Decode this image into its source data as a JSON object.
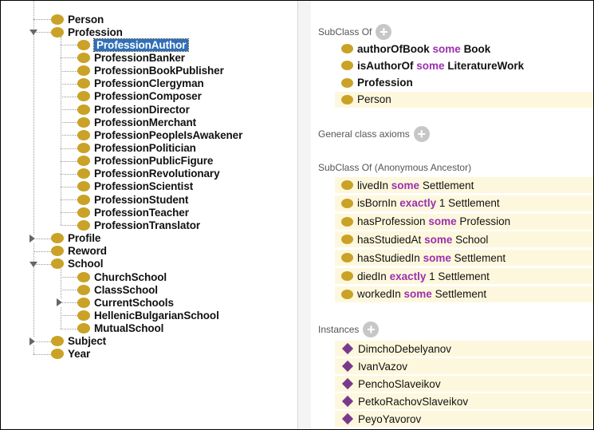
{
  "tree": {
    "items": [
      {
        "label": "Person",
        "level": 0,
        "expander": "none"
      },
      {
        "label": "Profession",
        "level": 0,
        "expander": "open"
      },
      {
        "label": "ProfessionAuthor",
        "level": 1,
        "expander": "none",
        "selected": true
      },
      {
        "label": "ProfessionBanker",
        "level": 1,
        "expander": "none"
      },
      {
        "label": "ProfessionBookPublisher",
        "level": 1,
        "expander": "none"
      },
      {
        "label": "ProfessionClergyman",
        "level": 1,
        "expander": "none"
      },
      {
        "label": "ProfessionComposer",
        "level": 1,
        "expander": "none"
      },
      {
        "label": "ProfessionDirector",
        "level": 1,
        "expander": "none"
      },
      {
        "label": "ProfessionMerchant",
        "level": 1,
        "expander": "none"
      },
      {
        "label": "ProfessionPeopleIsAwakener",
        "level": 1,
        "expander": "none"
      },
      {
        "label": "ProfessionPolitician",
        "level": 1,
        "expander": "none"
      },
      {
        "label": "ProfessionPublicFigure",
        "level": 1,
        "expander": "none"
      },
      {
        "label": "ProfessionRevolutionary",
        "level": 1,
        "expander": "none"
      },
      {
        "label": "ProfessionScientist",
        "level": 1,
        "expander": "none"
      },
      {
        "label": "ProfessionStudent",
        "level": 1,
        "expander": "none"
      },
      {
        "label": "ProfessionTeacher",
        "level": 1,
        "expander": "none"
      },
      {
        "label": "ProfessionTranslator",
        "level": 1,
        "expander": "none"
      },
      {
        "label": "Profile",
        "level": 0,
        "expander": "closed"
      },
      {
        "label": "Reword",
        "level": 0,
        "expander": "none"
      },
      {
        "label": "School",
        "level": 0,
        "expander": "open"
      },
      {
        "label": "ChurchSchool",
        "level": 1,
        "expander": "none"
      },
      {
        "label": "ClassSchool",
        "level": 1,
        "expander": "none"
      },
      {
        "label": "CurrentSchools",
        "level": 1,
        "expander": "closed"
      },
      {
        "label": "HellenicBulgarianSchool",
        "level": 1,
        "expander": "none"
      },
      {
        "label": "MutualSchool",
        "level": 1,
        "expander": "none"
      },
      {
        "label": "Subject",
        "level": 0,
        "expander": "closed"
      },
      {
        "label": "Year",
        "level": 0,
        "expander": "none"
      }
    ]
  },
  "sections": {
    "subclass_of": "SubClass Of",
    "general_axioms": "General class axioms",
    "anon_ancestor": "SubClass Of (Anonymous Ancestor)",
    "instances": "Instances",
    "plus_glyph": "+"
  },
  "subclass_of": [
    {
      "pre": "authorOfBook",
      "kw": "some",
      "post": "Book",
      "bold": true
    },
    {
      "pre": "isAuthorOf",
      "kw": "some",
      "post": "LiteratureWork",
      "bold": true
    },
    {
      "pre": "Profession",
      "kw": "",
      "post": "",
      "bold": true
    },
    {
      "pre": "Person",
      "kw": "",
      "post": "",
      "bold": false
    }
  ],
  "anon_ancestor": [
    {
      "pre": "livedIn",
      "kw": "some",
      "post": "Settlement"
    },
    {
      "pre": "isBornIn",
      "kw": "exactly",
      "post": "1 Settlement"
    },
    {
      "pre": "hasProfession",
      "kw": "some",
      "post": "Profession"
    },
    {
      "pre": "hasStudiedAt",
      "kw": "some",
      "post": "School"
    },
    {
      "pre": "hasStudiedIn",
      "kw": "some",
      "post": "Settlement"
    },
    {
      "pre": "diedIn",
      "kw": "exactly",
      "post": "1 Settlement"
    },
    {
      "pre": "workedIn",
      "kw": "some",
      "post": "Settlement"
    }
  ],
  "instances": [
    "DimchoDebelyanov",
    "IvanVazov",
    "PenchoSlaveikov",
    "PetkoRachovSlaveikov",
    "PeyoYavorov"
  ],
  "colors": {
    "class_dot": "#c9a227",
    "individual_diamond": "#7a3a8c",
    "keyword": "#9b2fb0",
    "axiom_bg": "#fdf8dd",
    "selection": "#2f6fb8"
  }
}
